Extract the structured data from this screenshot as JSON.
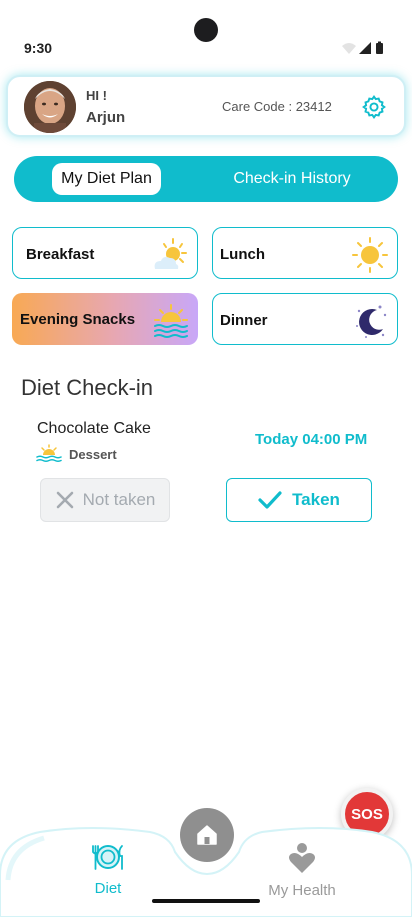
{
  "status_bar": {
    "time": "9:30"
  },
  "profile": {
    "greeting": "HI !",
    "name": "Arjun",
    "care_code": "Care Code : 23412"
  },
  "tabs": [
    {
      "label": "My Diet Plan",
      "active": true
    },
    {
      "label": "Check-in History",
      "active": false
    }
  ],
  "meals": [
    {
      "label": "Breakfast",
      "icon": "sun-cloud-icon"
    },
    {
      "label": "Lunch",
      "icon": "sun-icon"
    },
    {
      "label": "Evening Snacks",
      "icon": "sunset-icon"
    },
    {
      "label": "Dinner",
      "icon": "moon-stars-icon"
    }
  ],
  "checkin": {
    "title": "Diet Check-in",
    "food_name": "Chocolate Cake",
    "food_type": "Dessert",
    "time": "Today 04:00 PM",
    "not_taken_label": "Not taken",
    "taken_label": "Taken"
  },
  "sos_label": "SOS",
  "nav": {
    "diet_label": "Diet",
    "health_label": "My Health"
  },
  "colors": {
    "accent": "#10bccc",
    "sos": "#e23838"
  }
}
